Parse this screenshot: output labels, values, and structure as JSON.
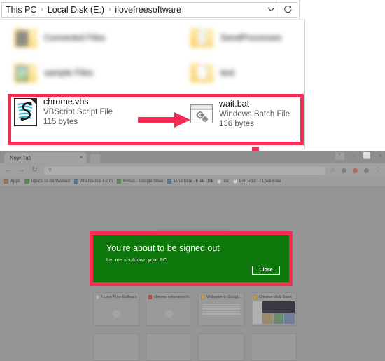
{
  "explorer": {
    "breadcrumb": {
      "items": [
        "This PC",
        "Local Disk (E:)",
        "ilovefreesoftware"
      ],
      "separator": "›",
      "chevron": "⌄",
      "refresh": "↻"
    },
    "blurred_items": [
      {
        "name": "Converted Files",
        "icon": "folder-icon"
      },
      {
        "name": "SendProcesses",
        "icon": "folder-icon"
      },
      {
        "name": "sample Files",
        "icon": "folder-icon"
      },
      {
        "name": "test",
        "icon": "folder-icon"
      }
    ],
    "highlighted_files": [
      {
        "name": "chrome.vbs",
        "type": "VBScript Script File",
        "size": "115 bytes",
        "icon": "vbscript-file-icon"
      },
      {
        "name": "wait.bat",
        "type": "Windows Batch File",
        "size": "136 bytes",
        "icon": "batch-file-icon"
      }
    ]
  },
  "annotations": {
    "highlight_color": "#f72c54",
    "arrow_right": "arrow-right-icon",
    "arrow_down": "arrow-down-icon"
  },
  "browser": {
    "tab": {
      "title": "New Tab",
      "close": "×"
    },
    "new_tab_label": "+",
    "window_controls": {
      "restore": "⤒",
      "minimize": "–",
      "maximize": "⬜",
      "close": "×"
    },
    "nav": {
      "back": "←",
      "forward": "→",
      "reload": "↻"
    },
    "omnibox": {
      "icon": "search-icon",
      "placeholder": ""
    },
    "toolbar_icons": [
      "star-icon",
      "extensions-icon",
      "profile-avatar-icon",
      "location-icon",
      "menu-icon"
    ],
    "bookmarks": [
      {
        "label": "Apps",
        "icon": "apps-icon"
      },
      {
        "label": "Topics To Be Worked",
        "icon": "sheets-icon"
      },
      {
        "label": "Attendance Form",
        "icon": "forms-icon"
      },
      {
        "label": "Bonus - Google Shee",
        "icon": "sheets-icon"
      },
      {
        "label": "VirusTotal - Free Onli",
        "icon": "virustotal-icon"
      },
      {
        "label": "isk",
        "icon": "page-icon"
      },
      {
        "label": "Edit Post - I Love Free",
        "icon": "page-icon"
      }
    ],
    "tiles": [
      {
        "label": "I Love Free Software",
        "icon": "page-icon",
        "thumb": "circle"
      },
      {
        "label": "chrome-extension://c",
        "icon": "extension-icon",
        "thumb": "circle"
      },
      {
        "label": "Welcome to Google C",
        "icon": "chrome-icon",
        "thumb": "lines"
      },
      {
        "label": "Chrome Web Store",
        "icon": "webstore-icon",
        "thumb": "screenshot"
      }
    ]
  },
  "dialog": {
    "title": "You're about to be signed out",
    "message": "Let me shutdown your PC",
    "close_label": "Close",
    "background_color": "#0f780d",
    "border_color": "#f72c54"
  }
}
